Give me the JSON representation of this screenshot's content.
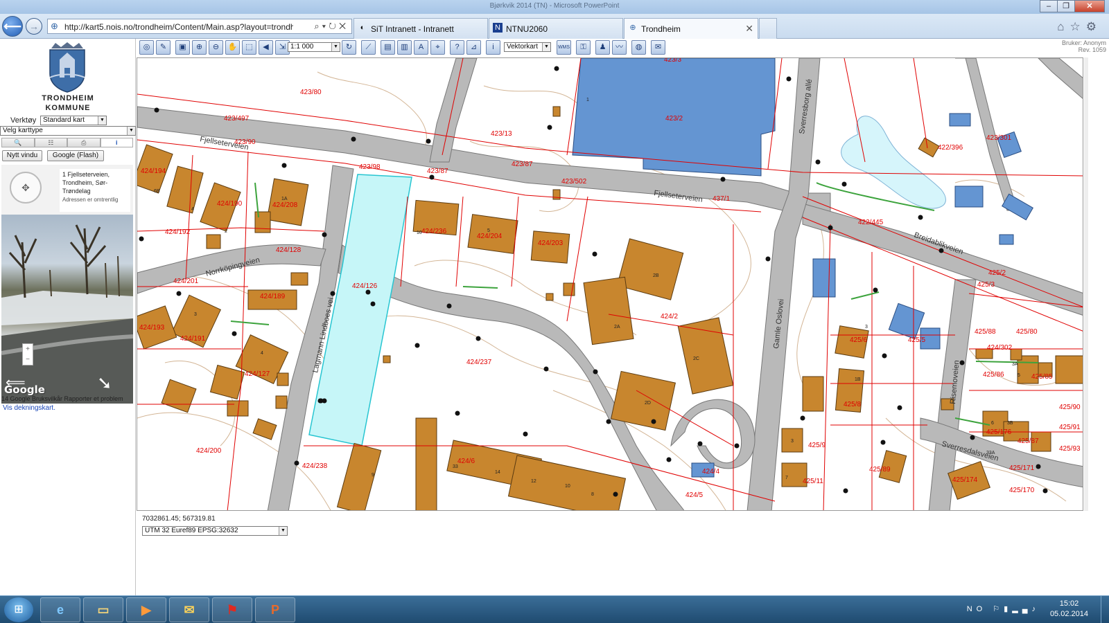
{
  "window": {
    "title": "Bjørkvik 2014 (TN) - Microsoft PowerPoint"
  },
  "browser": {
    "url": "http://kart5.nois.no/trondheim/Content/Main.asp?layout=trondh",
    "tabs": [
      {
        "label": "SiT Intranett - Intranett",
        "icon": "sit-icon"
      },
      {
        "label": "NTNU2060",
        "icon": "ntnu-icon"
      },
      {
        "label": "Trondheim",
        "icon": "globe-icon",
        "active": true
      }
    ]
  },
  "left_panel": {
    "logo_line1": "TRONDHEIM",
    "logo_line2": "KOMMUNE",
    "verktoy_label": "Verktøy",
    "verktoy_value": "Standard kart",
    "karttype_value": "Velg karttype",
    "buttons": {
      "new_window": "Nytt vindu",
      "google": "Google (Flash)"
    },
    "streetview": {
      "address": "1 Fjellseterveien, Trondheim, Sør-Trøndelag",
      "note": "Adressen er omtrentlig",
      "google_logo": "Google",
      "credits": "14 Google  Bruksvilkår  Rapporter et problem",
      "link": "Vis dekningskart."
    }
  },
  "toolbar": {
    "scale": "1:1 000",
    "map_type": "Vektorkart",
    "wms_label": "WMS",
    "user_line1": "Bruker: Anonym",
    "user_line2": "Rev. 1059"
  },
  "map": {
    "roads": [
      {
        "label": "Fjellseterveien"
      },
      {
        "label": "Fjellseterveien"
      },
      {
        "label": "Sverresborg allé"
      },
      {
        "label": "Breidablikveien"
      },
      {
        "label": "Norrköpingveien"
      },
      {
        "label": "Lagmann Lindboes vei"
      },
      {
        "label": "Gamle Oslovei"
      },
      {
        "label": "Risemoveien"
      },
      {
        "label": "Sverresdalsveien"
      }
    ],
    "parcels": [
      "423/3",
      "423/80",
      "423/497",
      "423/90",
      "423/13",
      "423/2",
      "423/87",
      "423/98",
      "423/87",
      "423/502",
      "437/1",
      "424/194",
      "424/190",
      "424/208",
      "424/192",
      "424/128",
      "424/201",
      "424/189",
      "424/193",
      "424/191",
      "424/127",
      "424/200",
      "424/236",
      "424/204",
      "424/203",
      "424/126",
      "424/237",
      "424/2",
      "424/238",
      "424/6",
      "424/4",
      "424/5",
      "423/301",
      "424/302",
      "422/396",
      "422/445",
      "425/2",
      "425/3",
      "425/80",
      "425/88",
      "425/5",
      "425/6",
      "425/8",
      "425/86",
      "425/85",
      "425/90",
      "425/91",
      "425/87",
      "425/176",
      "425/9",
      "425/11",
      "425/89",
      "425/171",
      "425/174",
      "425/170",
      "425/93"
    ],
    "house_numbers": [
      "1",
      "6B",
      "4",
      "2",
      "1A",
      "3",
      "4",
      "10",
      "5",
      "2A",
      "2B",
      "2C",
      "2D",
      "3",
      "1B",
      "3",
      "7",
      "9",
      "33",
      "14",
      "12",
      "10",
      "8",
      "6",
      "5",
      "3A",
      "3B",
      "33A"
    ]
  },
  "status": {
    "coordinates": "7032861.45; 567319.81",
    "projection": "UTM 32 Euref89 EPSG:32632"
  },
  "taskbar": {
    "language": "NO",
    "time": "15:02",
    "date": "05.02.2014",
    "apps": [
      "internet-explorer",
      "file-explorer",
      "media-player",
      "outlook",
      "acrobat",
      "powerpoint"
    ]
  },
  "colors": {
    "road": "#b9b9b9",
    "building_private": "#c8862e",
    "building_public": "#6495d2",
    "parcel_line": "#e00000",
    "contour": "#c8a27a",
    "highlight": "#c6f6f8"
  }
}
